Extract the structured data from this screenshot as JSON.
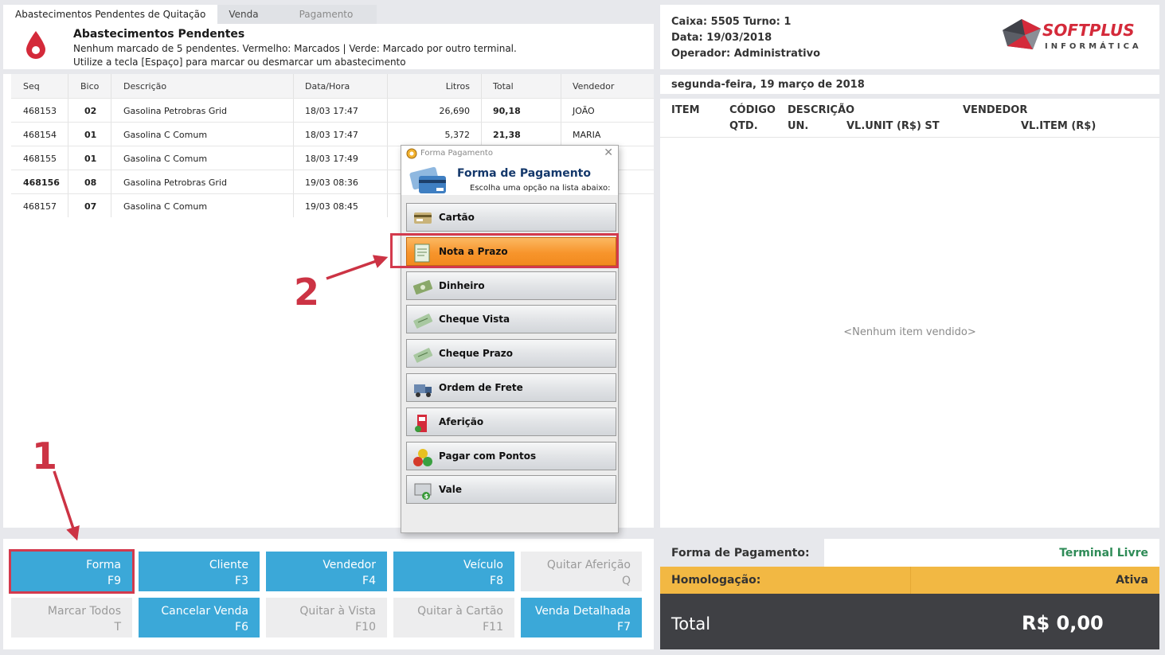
{
  "tabs": [
    {
      "label": "Abastecimentos Pendentes de Quitação"
    },
    {
      "label": "Venda"
    },
    {
      "label": "Pagamento"
    }
  ],
  "pending": {
    "title": "Abastecimentos Pendentes",
    "line1": "Nenhum marcado de 5 pendentes. Vermelho: Marcados | Verde: Marcado por outro terminal.",
    "line2": "Utilize a tecla [Espaço] para marcar ou desmarcar um abastecimento"
  },
  "table": {
    "headers": [
      "Seq",
      "Bico",
      "Descrição",
      "Data/Hora",
      "Litros",
      "Total",
      "Vendedor"
    ],
    "rows": [
      {
        "seq": "468153",
        "bico": "02",
        "desc": "Gasolina Petrobras Grid",
        "data": "18/03 17:47",
        "litros": "26,690",
        "total": "90,18",
        "vendedor": "JOÃO"
      },
      {
        "seq": "468154",
        "bico": "01",
        "desc": "Gasolina C Comum",
        "data": "18/03 17:47",
        "litros": "5,372",
        "total": "21,38",
        "vendedor": "MARIA"
      },
      {
        "seq": "468155",
        "bico": "01",
        "desc": "Gasolina C Comum",
        "data": "18/03 17:49",
        "litros": "",
        "total": "",
        "vendedor": ""
      },
      {
        "seq": "468156",
        "bico": "08",
        "desc": "Gasolina Petrobras Grid",
        "data": "19/03 08:36",
        "litros": "",
        "total": "",
        "vendedor": ""
      },
      {
        "seq": "468157",
        "bico": "07",
        "desc": "Gasolina C Comum",
        "data": "19/03 08:45",
        "litros": "",
        "total": "",
        "vendedor": ""
      }
    ]
  },
  "actions": [
    {
      "label": "Forma",
      "key": "F9",
      "enabled": true
    },
    {
      "label": "Cliente",
      "key": "F3",
      "enabled": true
    },
    {
      "label": "Vendedor",
      "key": "F4",
      "enabled": true
    },
    {
      "label": "Veículo",
      "key": "F8",
      "enabled": true
    },
    {
      "label": "Quitar Aferição",
      "key": "Q",
      "enabled": false
    },
    {
      "label": "Marcar Todos",
      "key": "T",
      "enabled": false
    },
    {
      "label": "Cancelar Venda",
      "key": "F6",
      "enabled": true
    },
    {
      "label": "Quitar à Vista",
      "key": "F10",
      "enabled": false
    },
    {
      "label": "Quitar à Cartão",
      "key": "F11",
      "enabled": false
    },
    {
      "label": "Venda Detalhada",
      "key": "F7",
      "enabled": true
    }
  ],
  "register": {
    "caixa": "Caixa: 5505 Turno: 1",
    "data": "Data: 19/03/2018",
    "operador": "Operador: Administrativo",
    "logo_main": "SOFTPLUS",
    "logo_sub": "INFORMÁTICA",
    "date_long": "segunda-feira, 19 março de 2018"
  },
  "items": {
    "headers_row1": [
      "ITEM",
      "CÓDIGO",
      "DESCRIÇÃO",
      "VENDEDOR"
    ],
    "headers_row2": [
      "QTD.",
      "UN.",
      "VL.UNIT (R$) ST",
      "VL.ITEM (R$)"
    ],
    "empty": "<Nenhum item vendido>"
  },
  "summary": {
    "payment_label": "Forma de Pagamento:",
    "payment_value": "Terminal Livre",
    "homolog_label": "Homologação:",
    "homolog_value": "Ativa",
    "total_label": "Total",
    "total_value": "R$ 0,00"
  },
  "dialog": {
    "window_title": "Forma Pagamento",
    "title": "Forma de Pagamento",
    "subtitle": "Escolha uma opção na lista abaixo:",
    "options": [
      {
        "label": "Cartão",
        "icon": "card-icon"
      },
      {
        "label": "Nota a Prazo",
        "icon": "note-icon",
        "selected": true
      },
      {
        "label": "Dinheiro",
        "icon": "money-icon"
      },
      {
        "label": "Cheque Vista",
        "icon": "check-icon"
      },
      {
        "label": "Cheque Prazo",
        "icon": "check-icon"
      },
      {
        "label": "Ordem de Frete",
        "icon": "truck-icon"
      },
      {
        "label": "Aferição",
        "icon": "pump-icon"
      },
      {
        "label": "Pagar com Pontos",
        "icon": "points-icon"
      },
      {
        "label": "Vale",
        "icon": "voucher-icon"
      }
    ]
  },
  "annotations": {
    "one": "1",
    "two": "2"
  }
}
